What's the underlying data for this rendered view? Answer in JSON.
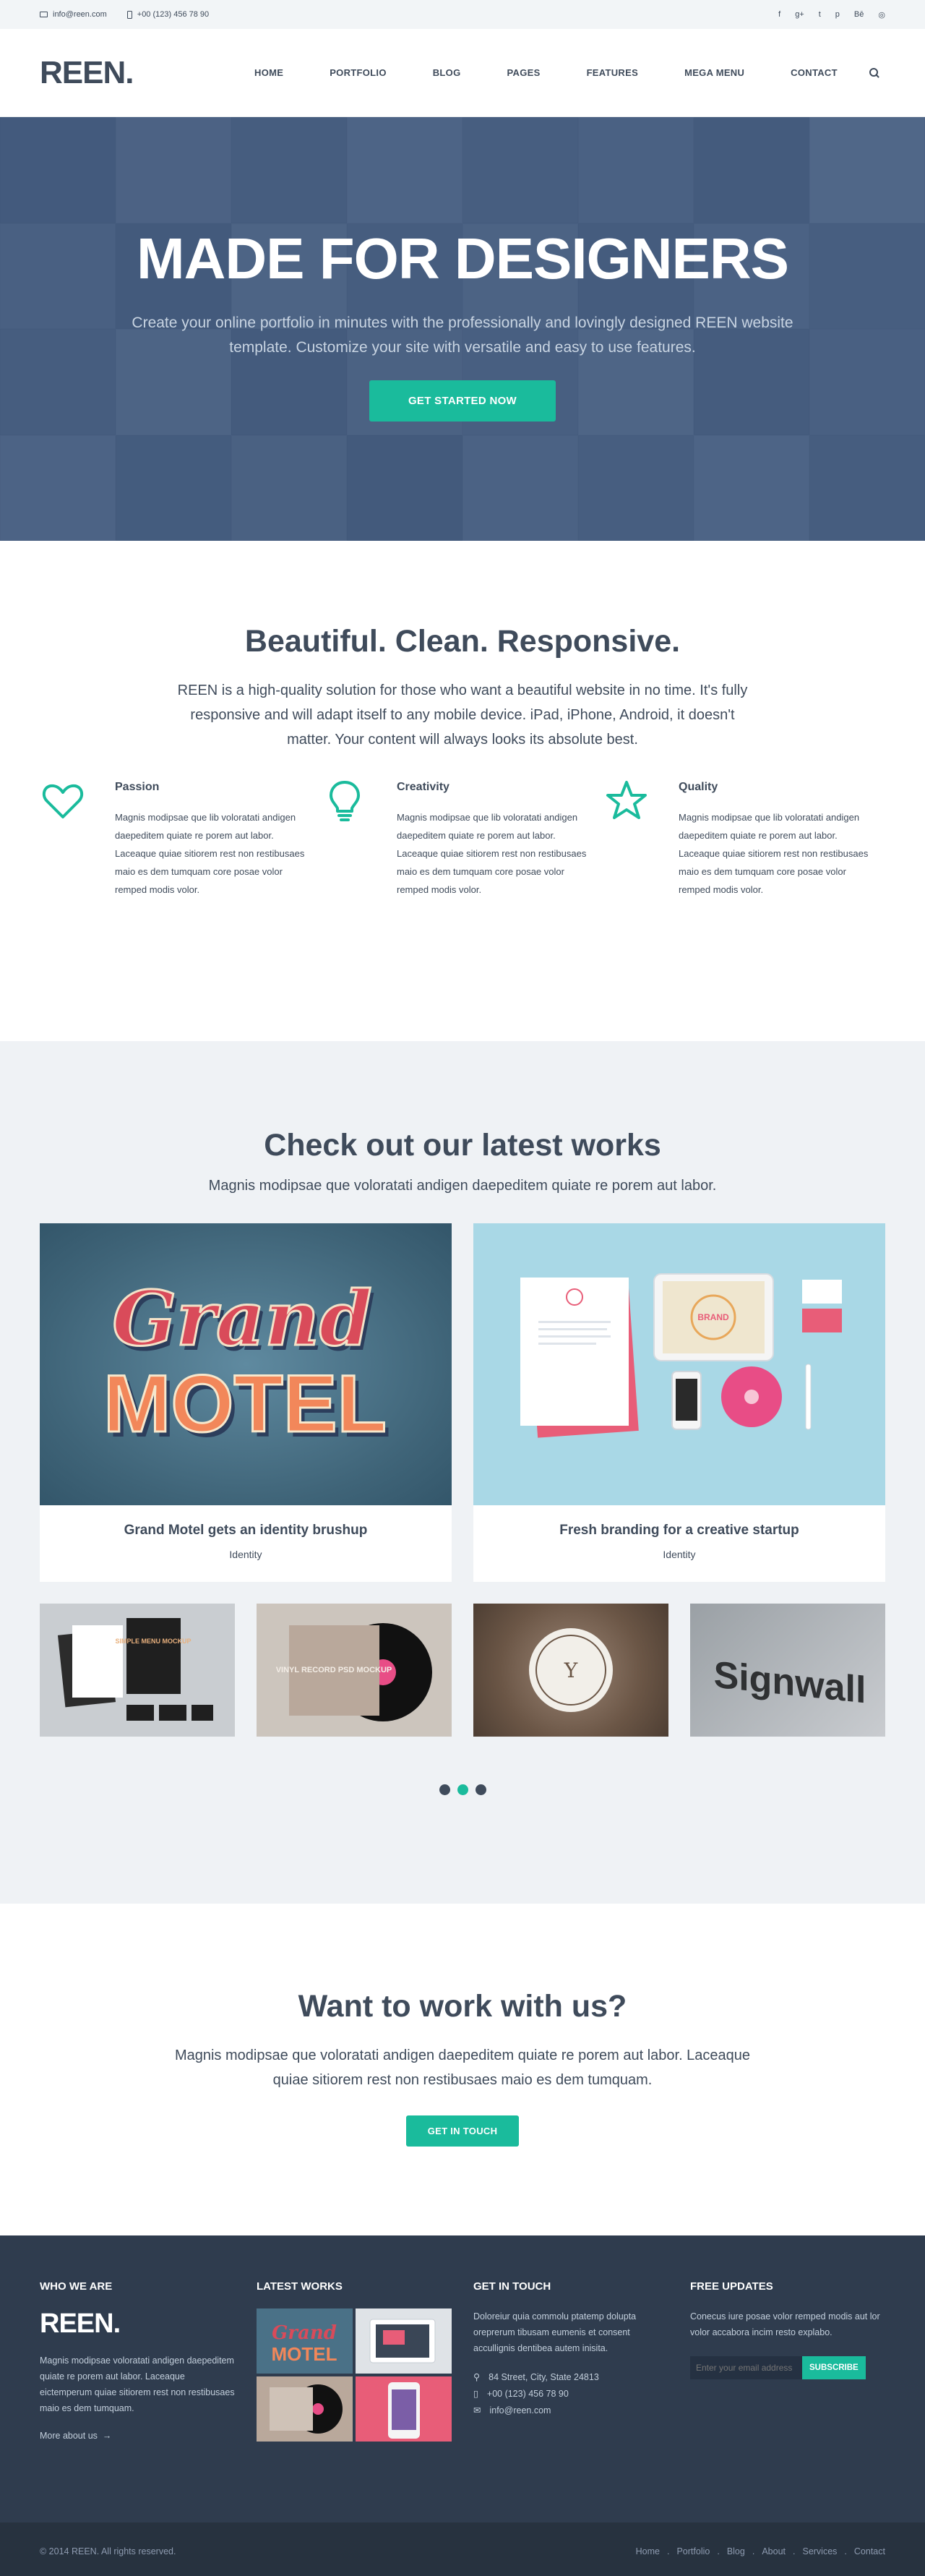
{
  "topbar": {
    "email": "info@reen.com",
    "phone": "+00 (123) 456 78 90",
    "social": [
      "f",
      "g+",
      "t",
      "p",
      "Bē",
      "◎"
    ]
  },
  "header": {
    "logo": "REEN.",
    "nav": [
      "HOME",
      "PORTFOLIO",
      "BLOG",
      "PAGES",
      "FEATURES",
      "MEGA MENU",
      "CONTACT"
    ]
  },
  "hero": {
    "title": "MADE FOR DESIGNERS",
    "subtitle": "Create your online portfolio in minutes with the professionally and lovingly designed REEN website template. Customize your site with versatile and easy to use features.",
    "button": "GET STARTED NOW"
  },
  "features": {
    "title": "Beautiful. Clean. Responsive.",
    "lead": "REEN is a high-quality solution for those who want a beautiful website in no time. It's fully responsive and will adapt itself to any mobile device. iPad, iPhone, Android, it doesn't matter. Your content will always looks its absolute best.",
    "items": [
      {
        "title": "Passion",
        "text": "Magnis modipsae que lib voloratati andigen daepeditem quiate re porem aut labor. Laceaque quiae sitiorem rest non restibusaes maio es dem tumquam core posae volor remped modis volor.",
        "icon": "heart-icon"
      },
      {
        "title": "Creativity",
        "text": "Magnis modipsae que lib voloratati andigen daepeditem quiate re porem aut labor. Laceaque quiae sitiorem rest non restibusaes maio es dem tumquam core posae volor remped modis volor.",
        "icon": "lightbulb-icon"
      },
      {
        "title": "Quality",
        "text": "Magnis modipsae que lib voloratati andigen daepeditem quiate re porem aut labor. Laceaque quiae sitiorem rest non restibusaes maio es dem tumquam core posae volor remped modis volor.",
        "icon": "star-icon"
      }
    ]
  },
  "works": {
    "title": "Check out our latest works",
    "lead": "Magnis modipsae que voloratati andigen daepeditem quiate re porem aut labor.",
    "big": [
      {
        "title": "Grand Motel gets an identity brushup",
        "category": "Identity",
        "art_line1": "Grand",
        "art_line2": "MOTEL"
      },
      {
        "title": "Fresh branding for a creative startup",
        "category": "Identity",
        "art_line1": "BRAND"
      }
    ],
    "small_art": [
      "SIMPLE MENU MOCKUP",
      "VINYL RECORD PSD MOCKUP",
      "Y",
      "Signwall"
    ]
  },
  "cta": {
    "title": "Want to work with us?",
    "text": "Magnis modipsae que voloratati andigen daepeditem quiate re porem aut labor. Laceaque quiae sitiorem rest non restibusaes maio es dem tumquam.",
    "button": "GET IN TOUCH"
  },
  "footer": {
    "who": {
      "heading": "WHO WE ARE",
      "logo": "REEN.",
      "text": "Magnis modipsae voloratati andigen daepeditem quiate re porem aut labor. Laceaque eictemperum quiae sitiorem rest non restibusaes maio es dem tumquam.",
      "more": "More about us"
    },
    "latest": {
      "heading": "LATEST WORKS"
    },
    "touch": {
      "heading": "GET IN TOUCH",
      "text": "Doloreiur quia commolu ptatemp dolupta oreprerum tibusam eumenis et consent accullignis dentibea autem inisita.",
      "address": "84 Street, City, State 24813",
      "phone": "+00 (123) 456 78 90",
      "email": "info@reen.com"
    },
    "updates": {
      "heading": "FREE UPDATES",
      "text": "Conecus iure posae volor remped modis aut lor volor accabora incim resto explabo.",
      "placeholder": "Enter your email address",
      "button": "SUBSCRIBE"
    }
  },
  "bottombar": {
    "copyright": "© 2014 REEN. All rights reserved.",
    "links": [
      "Home",
      "Portfolio",
      "Blog",
      "About",
      "Services",
      "Contact"
    ]
  },
  "colors": {
    "accent": "#1abb9c",
    "dark": "#3f4b5b",
    "footer": "#2f3c4e"
  }
}
